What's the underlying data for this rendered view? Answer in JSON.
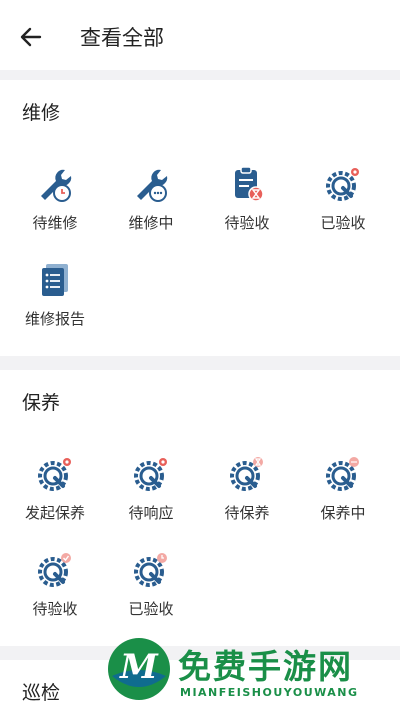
{
  "header": {
    "title": "查看全部"
  },
  "sections": [
    {
      "title": "维修",
      "items": [
        {
          "label": "待维修",
          "icon": "wrench-clock-icon"
        },
        {
          "label": "维修中",
          "icon": "wrench-dots-icon"
        },
        {
          "label": "待验收",
          "icon": "clipboard-hourglass-icon"
        },
        {
          "label": "已验收",
          "icon": "gear-wrench-check-icon"
        },
        {
          "label": "维修报告",
          "icon": "report-document-icon"
        }
      ]
    },
    {
      "title": "保养",
      "items": [
        {
          "label": "发起保养",
          "icon": "gear-wrench-start-icon"
        },
        {
          "label": "待响应",
          "icon": "gear-wrench-response-icon"
        },
        {
          "label": "待保养",
          "icon": "gear-wrench-hourglass-icon"
        },
        {
          "label": "保养中",
          "icon": "gear-wrench-dots-icon"
        },
        {
          "label": "待验收",
          "icon": "gear-wrench-check-icon"
        },
        {
          "label": "已验收",
          "icon": "gear-wrench-clock-icon"
        }
      ]
    },
    {
      "title": "巡检",
      "items": []
    }
  ],
  "watermark": {
    "main": "免费手游网",
    "sub": "MIANFEISHOUYOUWANG"
  },
  "colors": {
    "icon_blue": "#2a5d8f",
    "badge_red": "#e8605a",
    "brand_green": "#1a8f48"
  }
}
